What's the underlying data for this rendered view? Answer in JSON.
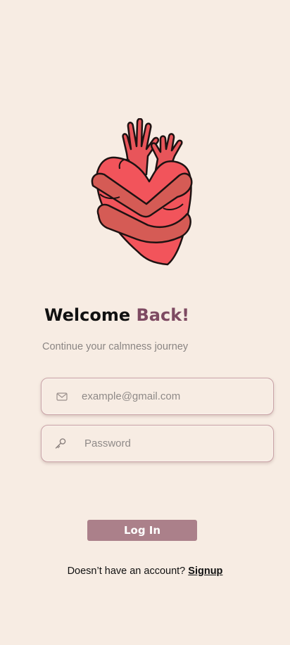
{
  "header": {
    "title_prefix": "Welcome",
    "title_accent": "Back!",
    "subtitle": "Continue your calmness journey"
  },
  "illustration": {
    "icon": "heart-hug-illustration",
    "colors": {
      "heart": "#f2545b",
      "arms": "#d55b55",
      "outline": "#1e1212"
    }
  },
  "form": {
    "email": {
      "icon": "mail-icon",
      "placeholder": "example@gmail.com",
      "value": ""
    },
    "password": {
      "icon": "key-icon",
      "placeholder": "Password",
      "value": ""
    },
    "login_label": "Log In"
  },
  "footer": {
    "prompt": "Doesn’t have an account?",
    "signup_label": "Signup"
  },
  "colors": {
    "background": "#f7ece3",
    "accent": "#7e4a62",
    "button": "#ab808a",
    "field_border": "#c9a3a6"
  }
}
